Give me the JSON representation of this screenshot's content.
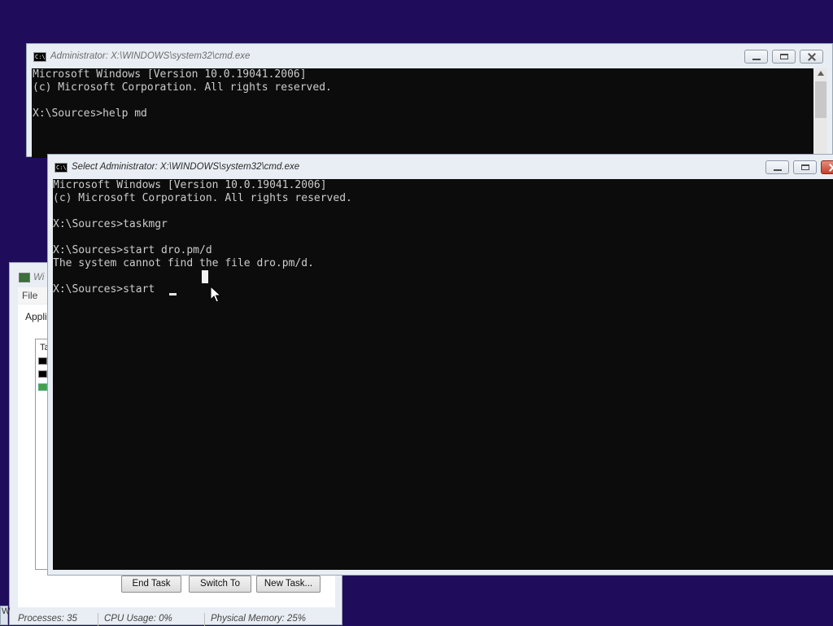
{
  "back_console": {
    "title": "Administrator: X:\\WINDOWS\\system32\\cmd.exe",
    "icon": "cmd-icon",
    "lines": [
      "Microsoft Windows [Version 10.0.19041.2006]",
      "(c) Microsoft Corporation. All rights reserved.",
      "",
      "X:\\Sources>help md"
    ]
  },
  "front_console": {
    "title": "Select Administrator: X:\\WINDOWS\\system32\\cmd.exe",
    "icon": "cmd-icon",
    "lines": [
      "Microsoft Windows [Version 10.0.19041.2006]",
      "(c) Microsoft Corporation. All rights reserved.",
      "",
      "X:\\Sources>taskmgr",
      "",
      "X:\\Sources>start dro.pm/d",
      "The system cannot find the file dro.pm/d.",
      "",
      "X:\\Sources>start "
    ]
  },
  "task_manager": {
    "title": "Wi",
    "menu_file": "File",
    "tab_applications": "Applic",
    "list_header": "Ta",
    "buttons": {
      "end_task": "End Task",
      "switch_to": "Switch To",
      "new_task": "New Task..."
    },
    "status": {
      "processes": "Processes: 35",
      "cpu": "CPU Usage: 0%",
      "memory": "Physical Memory: 25%"
    }
  },
  "taskbar_stub": "W",
  "colors": {
    "desktop": "#1f0d5c",
    "console_bg": "#0c0c0c",
    "console_fg": "#cccccc",
    "close_active": "#c4402b"
  }
}
